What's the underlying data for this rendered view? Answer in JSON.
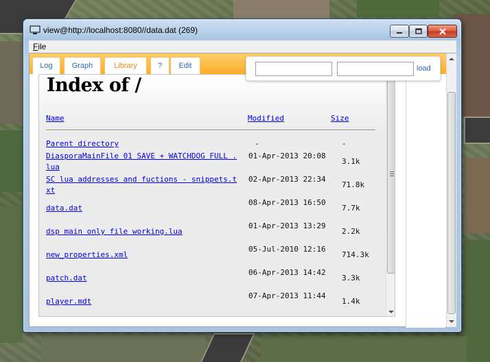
{
  "window": {
    "title": "view@http://localhost:8080//data.dat (269)"
  },
  "menu": {
    "file": "File"
  },
  "tabs": [
    {
      "label": "Log",
      "active": false
    },
    {
      "label": "Graph",
      "active": false
    },
    {
      "label": "Library",
      "active": true
    },
    {
      "label": "?",
      "active": false
    },
    {
      "label": "Edit",
      "active": false
    }
  ],
  "loader": {
    "input1_value": "",
    "input2_value": "",
    "load_label": "load"
  },
  "listing": {
    "heading": "Index of /",
    "columns": {
      "name": "Name",
      "modified": "Modified",
      "size": "Size"
    },
    "rows": [
      {
        "name": "Parent directory",
        "modified": "-",
        "size": "-"
      },
      {
        "name": "DiasporaMainFile 01 SAVE + WATCHDOG FULL .lua",
        "modified": "01-Apr-2013 20:08",
        "size": "3.1k"
      },
      {
        "name": "SC lua addresses and fuctions - snippets.txt",
        "modified": "02-Apr-2013 22:34",
        "size": "71.8k"
      },
      {
        "name": "data.dat",
        "modified": "08-Apr-2013 16:50",
        "size": "7.7k"
      },
      {
        "name": "dsp main only file working.lua",
        "modified": "01-Apr-2013 13:29",
        "size": "2.2k"
      },
      {
        "name": "new_properties.xml",
        "modified": "05-Jul-2010 12:16",
        "size": "714.3k"
      },
      {
        "name": "patch.dat",
        "modified": "06-Apr-2013 14:42",
        "size": "3.3k"
      },
      {
        "name": "player.mdt",
        "modified": "07-Apr-2013 11:44",
        "size": "1.4k"
      }
    ]
  },
  "colors": {
    "toolbar": "#fcae2a",
    "link": "#0000ee",
    "tab_text": "#2b6cb8",
    "tab_active_text": "#e38d12"
  }
}
